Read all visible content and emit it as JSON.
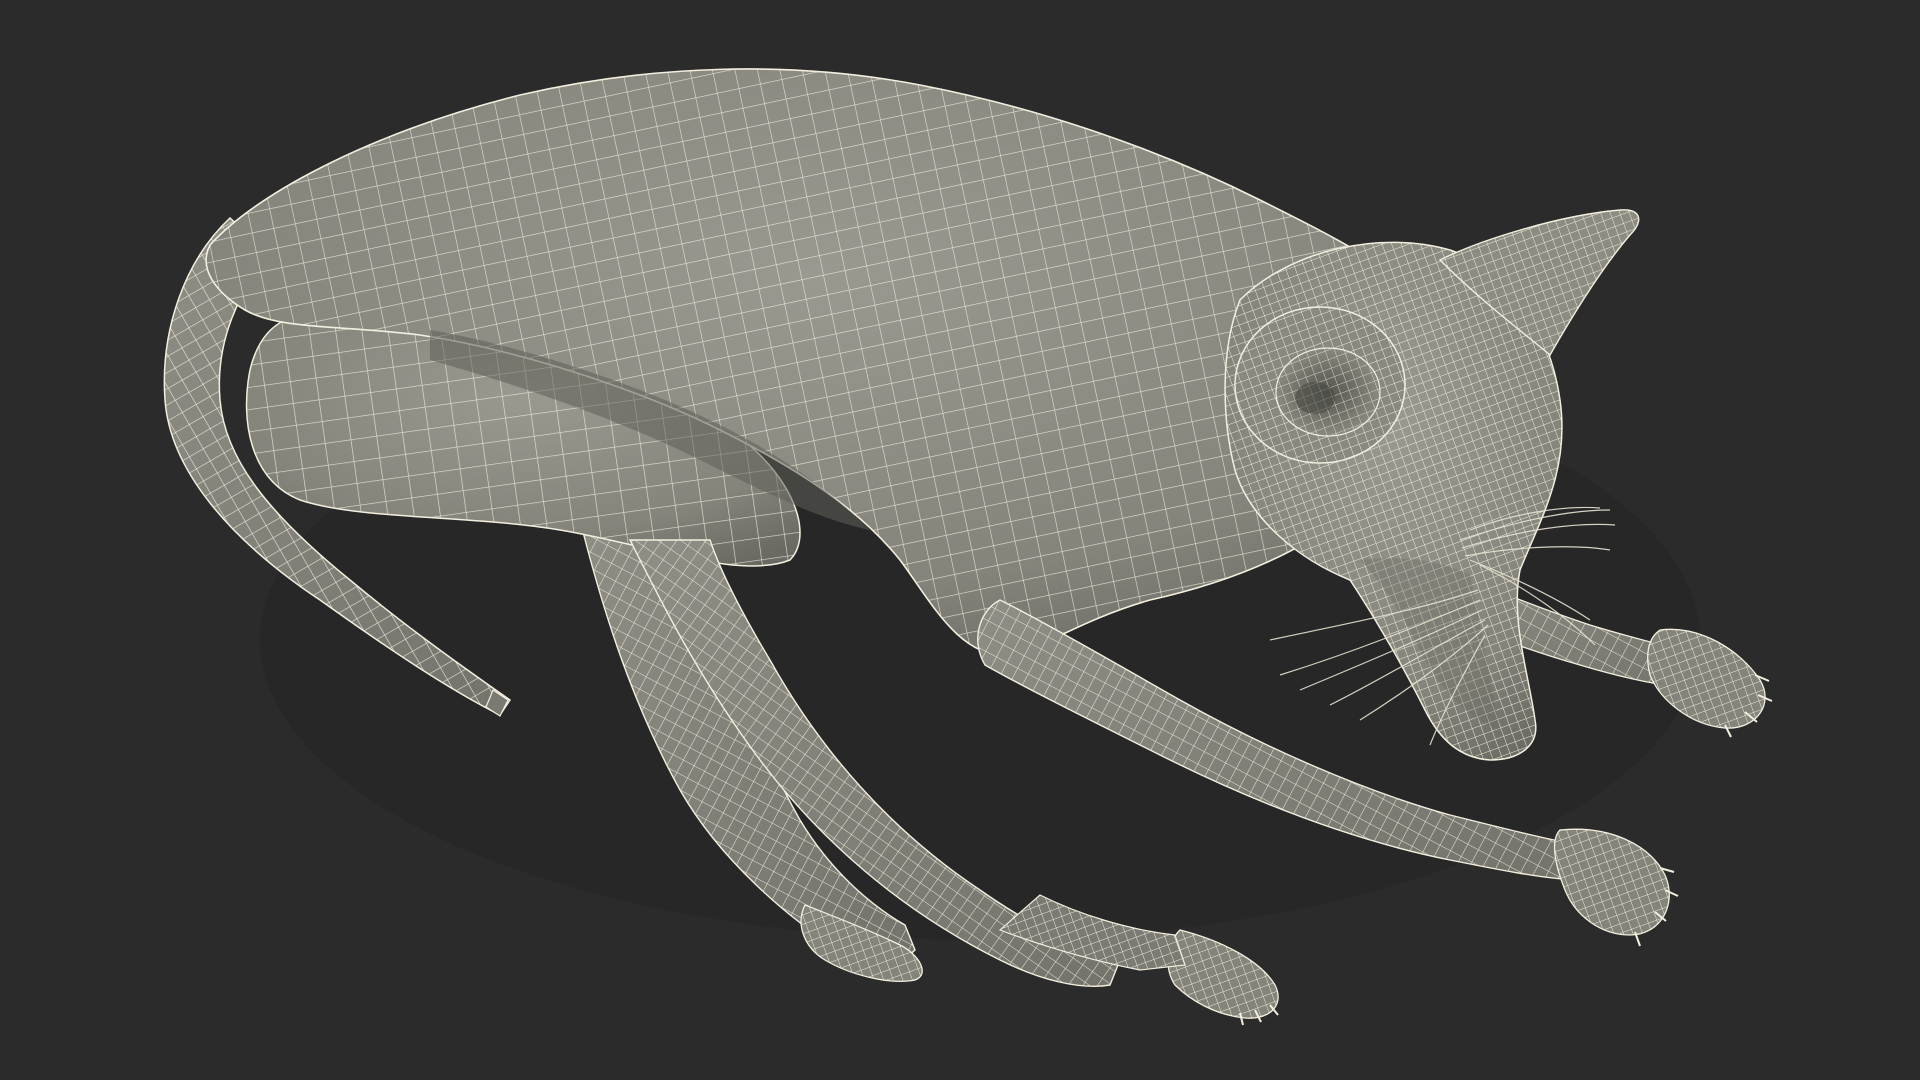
{
  "scene": {
    "subject": "wireframe-cat-model",
    "colors": {
      "background": "#2b2b2b",
      "surface": "#8e8d83",
      "surface_dark": "#6f6e66",
      "surface_shadow": "#5c5b55",
      "wire": "#f3efdf",
      "whisker": "#e9e4d2",
      "ground_shadow": "#1d1d1d"
    },
    "parts": [
      "tail",
      "hind-leg-thigh",
      "hind-leg-shin",
      "hind-paw",
      "back-hind-leg",
      "back-hind-paw",
      "torso",
      "head",
      "ear-front",
      "ear-back",
      "front-leg-near",
      "front-paw-near",
      "front-leg-far",
      "front-paw-far",
      "whiskers"
    ]
  }
}
